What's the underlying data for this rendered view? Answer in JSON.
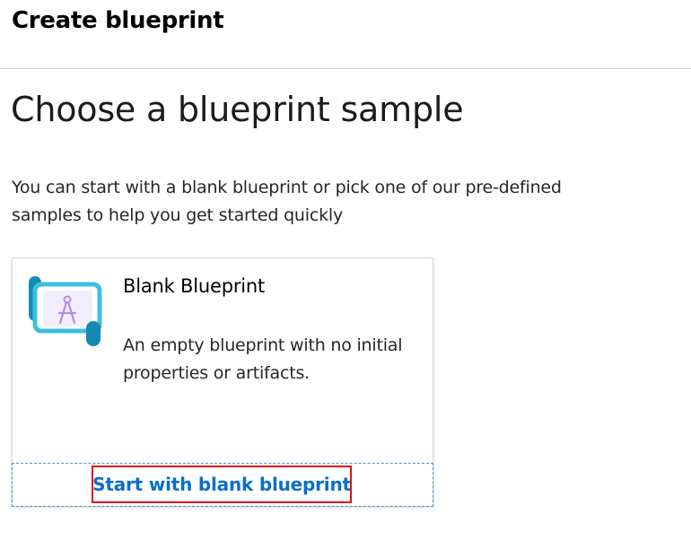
{
  "header": {
    "title": "Create blueprint"
  },
  "main": {
    "heading": "Choose a blueprint sample",
    "description": "You can start with a blank blueprint or pick one of our pre-defined samples to help you get started quickly"
  },
  "samples": [
    {
      "icon": "blueprint-scroll-icon",
      "title": "Blank Blueprint",
      "description": "An empty blueprint with no initial properties or artifacts.",
      "action_label": "Start with blank blueprint"
    }
  ],
  "colors": {
    "link": "#0b6fc9",
    "highlight": "#e0101a",
    "icon_scroll": "#1ea0c8",
    "icon_drawing": "#b48ce6"
  }
}
